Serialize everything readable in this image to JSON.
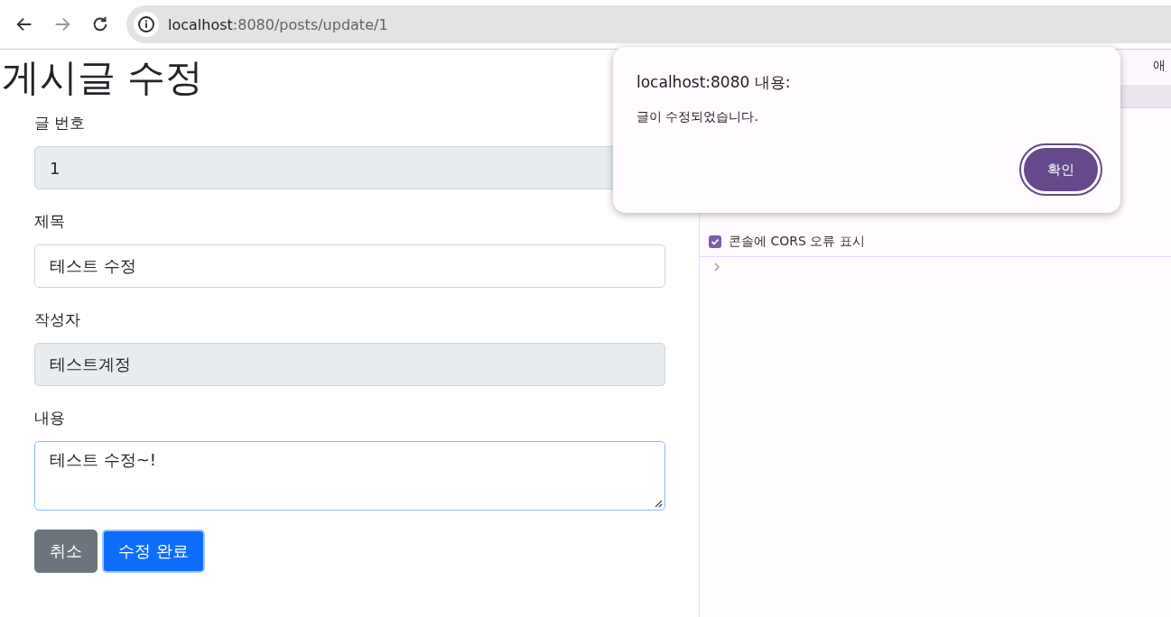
{
  "browser": {
    "url_host": "localhost",
    "url_rest": ":8080/posts/update/1"
  },
  "page": {
    "title": "게시글 수정",
    "fields": [
      {
        "label": "글 번호",
        "kind": "input",
        "value": "1",
        "disabled": true
      },
      {
        "label": "제목",
        "kind": "input",
        "value": "테스트 수정",
        "disabled": false
      },
      {
        "label": "작성자",
        "kind": "input",
        "value": "테스트계정",
        "disabled": true
      },
      {
        "label": "내용",
        "kind": "textarea",
        "value": "테스트 수정~!",
        "disabled": false
      }
    ],
    "buttons": [
      {
        "label": "취소",
        "kind": "secondary"
      },
      {
        "label": "수정 완료",
        "kind": "primary"
      }
    ]
  },
  "devtools": {
    "tab_partial": "애",
    "settings": [
      {
        "label": "콘솔에 CORS 오류 표시",
        "checked": true
      }
    ]
  },
  "dialog": {
    "title": "localhost:8080 내용:",
    "message": "글이 수정되었습니다.",
    "button": "확인"
  }
}
